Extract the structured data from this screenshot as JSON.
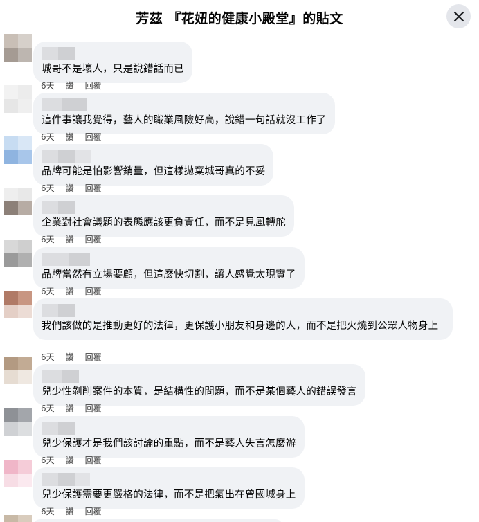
{
  "header": {
    "title": "芳茲 『花妞的健康小殿堂』的貼文"
  },
  "actions": {
    "time": "6天",
    "like": "讚",
    "reply": "回覆"
  },
  "comments": [
    {
      "text": "城哥不是壞人，只是說錯話而已"
    },
    {
      "text": "這件事讓我覺得，藝人的職業風險好高，說錯一句話就沒工作了"
    },
    {
      "text": "品牌可能是怕影響銷量，但這樣拋棄城哥真的不妥"
    },
    {
      "text": "企業對社會議題的表態應該更負責任，而不是見風轉舵"
    },
    {
      "text": "品牌當然有立場要顧，但這麼快切割，讓人感覺太現實了"
    },
    {
      "text": "我們該做的是推動更好的法律，更保護小朋友和身邊的人，而不是把火燒到公眾人物身上"
    },
    {
      "text": "兒少性剝削案件的本質，是結構性的問題，而不是某個藝人的錯誤發言"
    },
    {
      "text": "兒少保護才是我們該討論的重點，而不是藝人失言怎麼辦"
    },
    {
      "text": "兒少保護需要更嚴格的法律，而不是把氣出在曾國城身上"
    }
  ]
}
